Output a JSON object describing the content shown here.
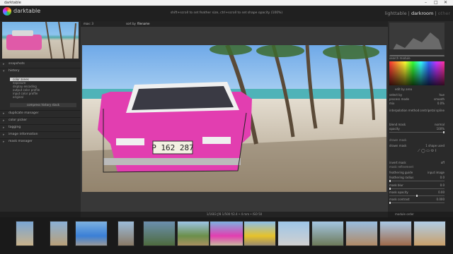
{
  "window": {
    "title": "darktable",
    "controls": [
      "–",
      "□",
      "✕"
    ]
  },
  "header": {
    "logo_text": "darktable",
    "hint": "shift+scroll to set feather size, ctrl+scroll to set shape opacity (100%)",
    "views": {
      "lighttable": "lighttable",
      "sep1": "|",
      "darkroom": "darkroom",
      "sep2": "|",
      "other": "other"
    }
  },
  "left_panel": {
    "sections": {
      "snapshots": "snapshots",
      "history": "history",
      "duplicate": "duplicate manager",
      "color_picker": "color picker",
      "tagging": "tagging",
      "image_info": "image information",
      "mask_manager": "mask manager"
    },
    "history_items": [
      "color zones",
      "exposure",
      "display encoding",
      "output color profile",
      "input color profile",
      "original"
    ],
    "compress_label": "compress history stack"
  },
  "center": {
    "top_left": "max: 3",
    "sort_label": "sort by",
    "sort_value": "filename",
    "info": "1/1603 ƒ/8 1/500 f/2.4 • 4 mm • ISO 50",
    "plate": "P 162 287"
  },
  "right_panel": {
    "header": "search module",
    "edit_by_area": "edit by area",
    "rows": [
      {
        "label": "select by",
        "value": "hue"
      },
      {
        "label": "process mode",
        "value": "smooth"
      },
      {
        "label": "mix",
        "value": "0.0%"
      },
      {
        "label": "interpolation method",
        "value": "centripetal spline"
      },
      {
        "label": "blend mask",
        "value": "normal"
      },
      {
        "label": "opacity",
        "value": "100%"
      },
      {
        "label": "drawn mask",
        "value": ""
      },
      {
        "label": "drawn mask",
        "value": "1 shape used"
      },
      {
        "label": "invert mask",
        "value": "off"
      },
      {
        "label": "mask refinement",
        "value": ""
      },
      {
        "label": "feathering guide",
        "value": "input image"
      },
      {
        "label": "feathering radius",
        "value": "0.0"
      },
      {
        "label": "mask blur",
        "value": "0.0"
      },
      {
        "label": "mask opacity",
        "value": "0.00"
      },
      {
        "label": "mask contrast",
        "value": "0.000"
      }
    ],
    "module_order": "module order"
  },
  "colors": {
    "accent": "#e23eb0",
    "panel": "#2a2a2a",
    "canvas": "#383838"
  }
}
